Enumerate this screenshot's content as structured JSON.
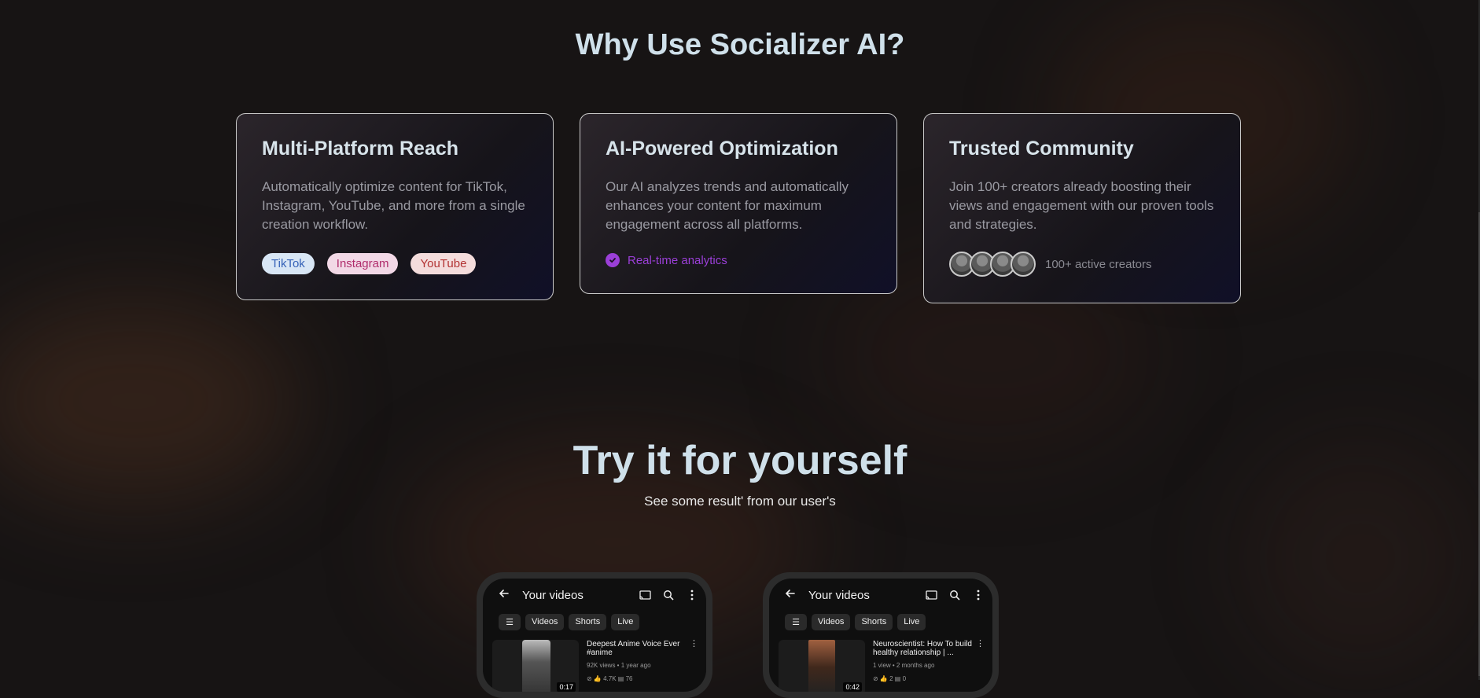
{
  "why": {
    "title": "Why Use Socializer AI?",
    "cards": [
      {
        "title": "Multi-Platform Reach",
        "text": "Automatically optimize content for TikTok, Instagram, YouTube, and more from a single creation workflow.",
        "pills": [
          "TikTok",
          "Instagram",
          "YouTube"
        ]
      },
      {
        "title": "AI-Powered Optimization",
        "text": "Our AI analyzes trends and automatically enhances your content for maximum engagement across all platforms.",
        "feature": "Real-time analytics"
      },
      {
        "title": "Trusted Community",
        "text": "Join 100+ creators already boosting their views and engagement with our proven tools and strategies.",
        "creators_label": "100+ active creators"
      }
    ]
  },
  "try": {
    "title": "Try it for yourself",
    "subtitle": "See some result' from our user's"
  },
  "phones": [
    {
      "header": "Your videos",
      "chips": [
        "Videos",
        "Shorts",
        "Live"
      ],
      "video": {
        "title": "Deepest Anime Voice Ever #anime",
        "meta": "92K views • 1 year ago",
        "stats": "⊘  👍 4.7K  ▤ 76",
        "duration": "0:17"
      }
    },
    {
      "header": "Your videos",
      "chips": [
        "Videos",
        "Shorts",
        "Live"
      ],
      "video": {
        "title": "Neuroscientist: How To build healthy relationship | ...",
        "meta": "1 view • 2 months ago",
        "stats": "⊘  👍 2  ▤ 0",
        "duration": "0:42"
      }
    }
  ],
  "colors": {
    "background": "#171414",
    "heading": "#cfe0ea",
    "accent_purple": "#9b3fd8"
  },
  "icons": {
    "feature": "check-circle-icon",
    "phone_back": "arrow-left-icon",
    "phone_cast": "cast-icon",
    "phone_search": "search-icon",
    "phone_more": "more-vertical-icon",
    "phone_filter": "filter-icon"
  }
}
